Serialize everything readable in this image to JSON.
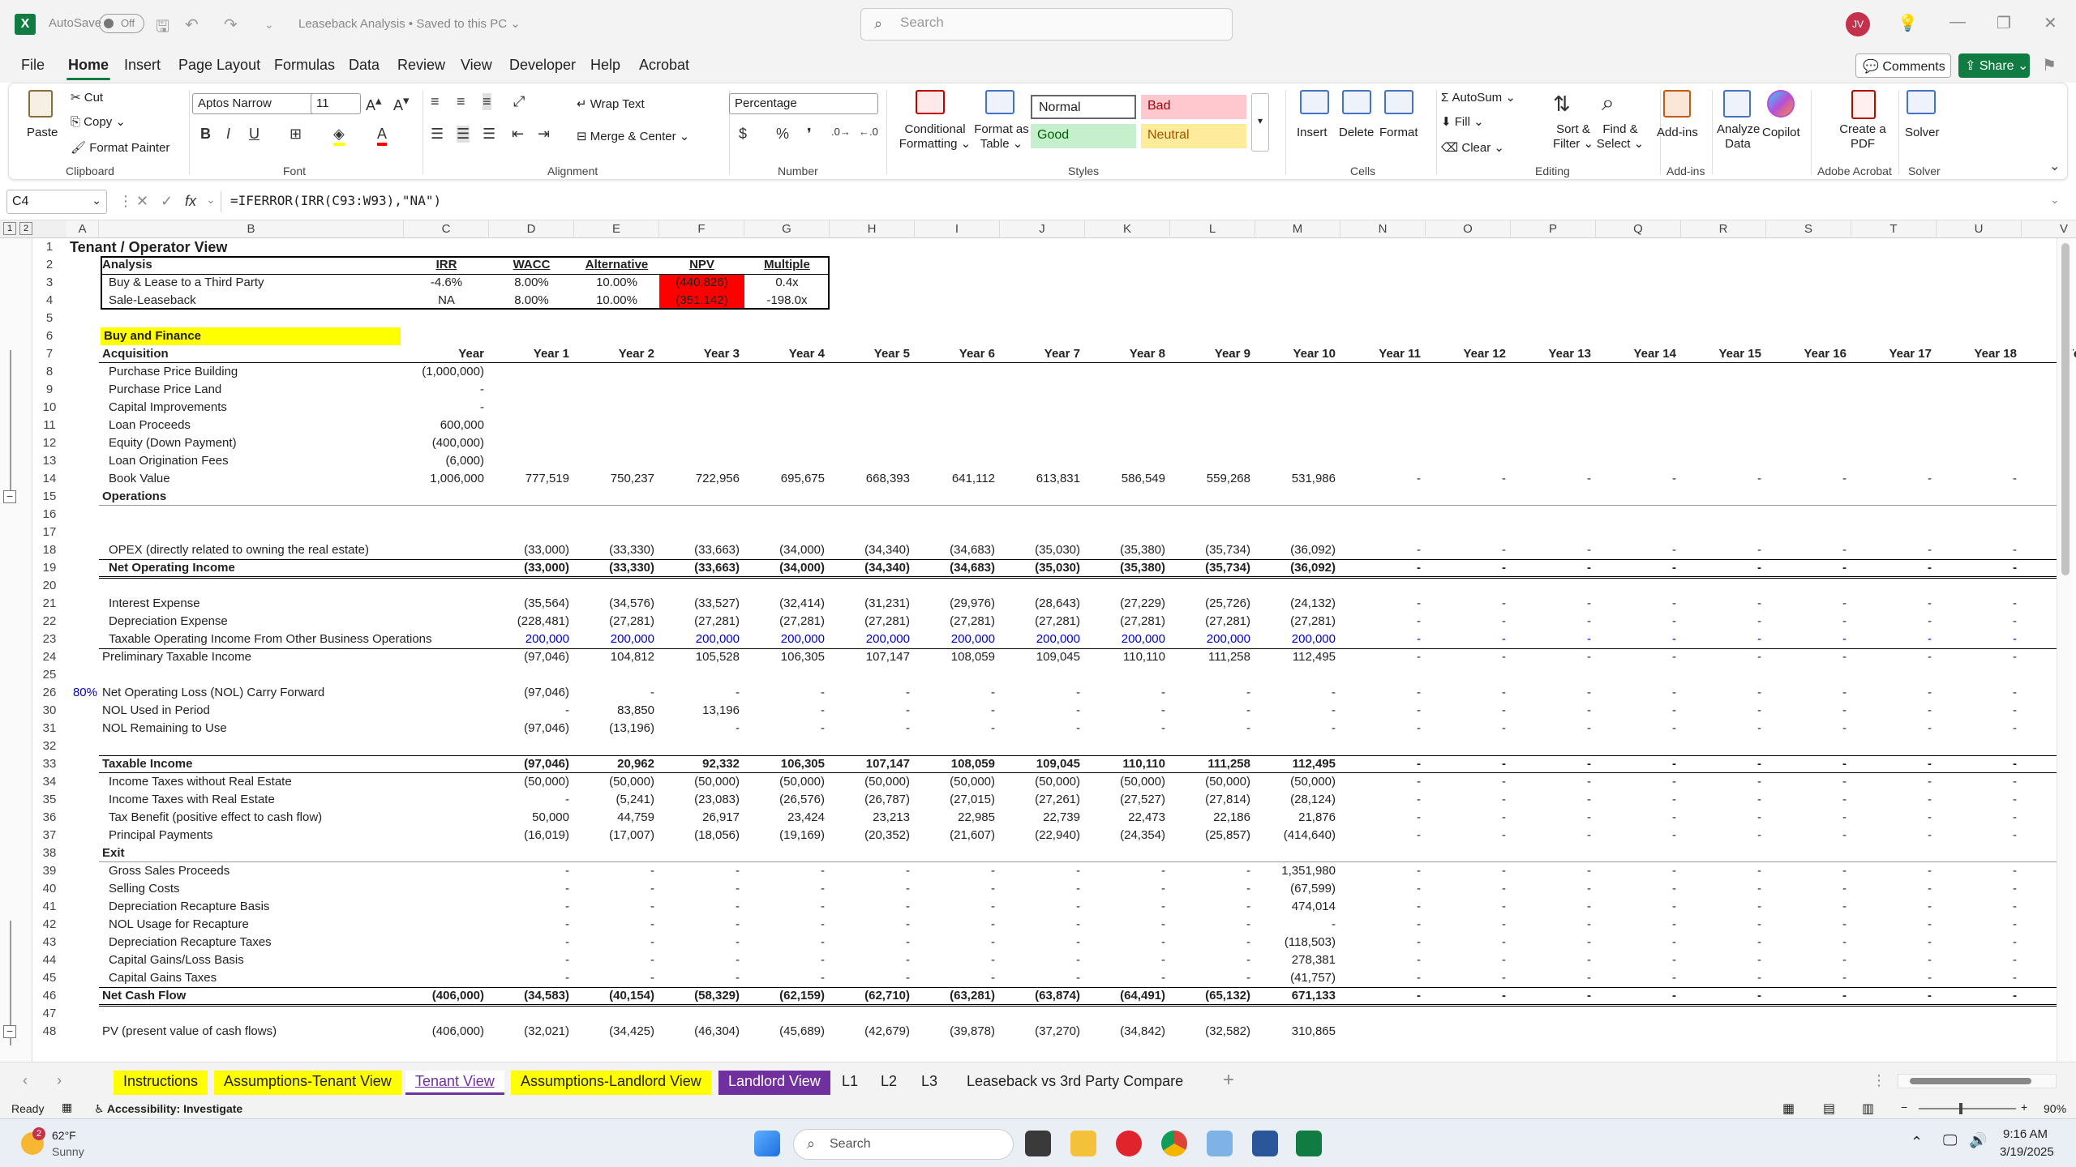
{
  "title": {
    "autosave": "AutoSave",
    "toggle": "Off",
    "doc": "Leaseback Analysis • Saved to this PC ⌄",
    "search": "Search",
    "avatar": "JV"
  },
  "menu": [
    "File",
    "Home",
    "Insert",
    "Page Layout",
    "Formulas",
    "Data",
    "Review",
    "View",
    "Developer",
    "Help",
    "Acrobat"
  ],
  "actions": {
    "comments": "Comments",
    "share": "Share ⌄"
  },
  "ribbon": {
    "clipboard": {
      "paste": "Paste",
      "cut": "Cut",
      "copy": "Copy ⌄",
      "format_painter": "Format Painter",
      "label": "Clipboard"
    },
    "font": {
      "name": "Aptos Narrow",
      "size": "11",
      "label": "Font"
    },
    "alignment": {
      "wrap": "Wrap Text",
      "merge": "Merge & Center ⌄",
      "label": "Alignment"
    },
    "number": {
      "format": "Percentage",
      "label": "Number"
    },
    "styles": {
      "cond": "Conditional Formatting ⌄",
      "table": "Format as Table ⌄",
      "normal": "Normal",
      "bad": "Bad",
      "good": "Good",
      "neutral": "Neutral",
      "label": "Styles"
    },
    "cells": {
      "insert": "Insert",
      "delete": "Delete",
      "format": "Format",
      "label": "Cells"
    },
    "editing": {
      "autosum": "AutoSum ⌄",
      "fill": "Fill ⌄",
      "clear": "Clear ⌄",
      "sort": "Sort & Filter ⌄",
      "find": "Find & Select ⌄",
      "label": "Editing"
    },
    "addins": {
      "addins": "Add-ins",
      "analyze": "Analyze Data",
      "copilot": "Copilot",
      "label": "Add-ins"
    },
    "acrobat": {
      "create": "Create a PDF",
      "label": "Adobe Acrobat"
    },
    "solver": {
      "solver": "Solver",
      "label": "Solver"
    }
  },
  "formula_bar": {
    "cell": "C4",
    "formula": "=IFERROR(IRR(C93:W93),\"NA\")"
  },
  "columns": [
    "A",
    "B",
    "C",
    "D",
    "E",
    "F",
    "G",
    "H",
    "I",
    "J",
    "K",
    "L",
    "M",
    "N",
    "O",
    "P",
    "Q",
    "R",
    "S",
    "T",
    "U",
    "V"
  ],
  "rows": [
    "1",
    "2",
    "3",
    "4",
    "5",
    "6",
    "7",
    "8",
    "9",
    "10",
    "11",
    "12",
    "13",
    "14",
    "15",
    "16",
    "17",
    "18",
    "19",
    "20",
    "21",
    "22",
    "23",
    "24",
    "25",
    "26",
    "30",
    "31",
    "32",
    "33",
    "34",
    "35",
    "36",
    "37",
    "38",
    "39",
    "40",
    "41",
    "42",
    "43",
    "44",
    "45",
    "46",
    "47",
    "48"
  ],
  "sheet": {
    "title": "Tenant / Operator View",
    "analysis": {
      "headers": [
        "Analysis",
        "IRR",
        "WACC",
        "Alternative",
        "NPV",
        "Multiple"
      ],
      "rows": [
        [
          "Buy & Lease to a Third Party",
          "-4.6%",
          "8.00%",
          "10.00%",
          "(440,826)",
          "0.4x"
        ],
        [
          "Sale-Leaseback",
          "NA",
          "8.00%",
          "10.00%",
          "(351,142)",
          "-198.0x"
        ]
      ]
    },
    "section_buy": "Buy and Finance",
    "acq_label": "Acquisition",
    "year_label": "Year",
    "years": [
      "Year 1",
      "Year 2",
      "Year 3",
      "Year 4",
      "Year 5",
      "Year 6",
      "Year 7",
      "Year 8",
      "Year 9",
      "Year 10",
      "Year 11",
      "Year 12",
      "Year 13",
      "Year 14",
      "Year 15",
      "Year 16",
      "Year 17",
      "Year 18",
      "Year 1"
    ],
    "acquisition": [
      [
        "Purchase Price Building",
        "(1,000,000)"
      ],
      [
        "Purchase Price Land",
        "-"
      ],
      [
        "Capital Improvements",
        "-"
      ],
      [
        "Loan Proceeds",
        "600,000"
      ],
      [
        "Equity (Down Payment)",
        "(400,000)"
      ],
      [
        "Loan Origination Fees",
        "(6,000)"
      ]
    ],
    "book_value": {
      "label": "Book Value",
      "c": "1,006,000",
      "vals": [
        "777,519",
        "750,237",
        "722,956",
        "695,675",
        "668,393",
        "641,112",
        "613,831",
        "586,549",
        "559,268",
        "531,986",
        "-",
        "-",
        "-",
        "-",
        "-",
        "-",
        "-",
        "-"
      ]
    },
    "operations": "Operations",
    "opex": {
      "label": "OPEX (directly related to owning the real estate)",
      "vals": [
        "(33,000)",
        "(33,330)",
        "(33,663)",
        "(34,000)",
        "(34,340)",
        "(34,683)",
        "(35,030)",
        "(35,380)",
        "(35,734)",
        "(36,092)",
        "-",
        "-",
        "-",
        "-",
        "-",
        "-",
        "-",
        "-"
      ]
    },
    "noi": {
      "label": "Net Operating Income",
      "vals": [
        "(33,000)",
        "(33,330)",
        "(33,663)",
        "(34,000)",
        "(34,340)",
        "(34,683)",
        "(35,030)",
        "(35,380)",
        "(35,734)",
        "(36,092)",
        "-",
        "-",
        "-",
        "-",
        "-",
        "-",
        "-",
        "-"
      ]
    },
    "interest": {
      "label": "Interest Expense",
      "vals": [
        "(35,564)",
        "(34,576)",
        "(33,527)",
        "(32,414)",
        "(31,231)",
        "(29,976)",
        "(28,643)",
        "(27,229)",
        "(25,726)",
        "(24,132)",
        "-",
        "-",
        "-",
        "-",
        "-",
        "-",
        "-",
        "-"
      ]
    },
    "depreciation": {
      "label": "Depreciation Expense",
      "vals": [
        "(228,481)",
        "(27,281)",
        "(27,281)",
        "(27,281)",
        "(27,281)",
        "(27,281)",
        "(27,281)",
        "(27,281)",
        "(27,281)",
        "(27,281)",
        "-",
        "-",
        "-",
        "-",
        "-",
        "-",
        "-",
        "-"
      ]
    },
    "taxable_other": {
      "label": "Taxable Operating Income From Other Business Operations",
      "vals": [
        "200,000",
        "200,000",
        "200,000",
        "200,000",
        "200,000",
        "200,000",
        "200,000",
        "200,000",
        "200,000",
        "200,000",
        "-",
        "-",
        "-",
        "-",
        "-",
        "-",
        "-",
        "-"
      ]
    },
    "prelim": {
      "label": "Preliminary Taxable Income",
      "vals": [
        "(97,046)",
        "104,812",
        "105,528",
        "106,305",
        "107,147",
        "108,059",
        "109,045",
        "110,110",
        "111,258",
        "112,495",
        "-",
        "-",
        "-",
        "-",
        "-",
        "-",
        "-",
        "-"
      ]
    },
    "nol_pct": "80%",
    "nol_cf": {
      "label": "Net Operating Loss (NOL) Carry Forward",
      "vals": [
        "(97,046)",
        "-",
        "-",
        "-",
        "-",
        "-",
        "-",
        "-",
        "-",
        "-",
        "-",
        "-",
        "-",
        "-",
        "-",
        "-",
        "-",
        "-"
      ]
    },
    "nol_used": {
      "label": "NOL Used in Period",
      "vals": [
        "-",
        "83,850",
        "13,196",
        "-",
        "-",
        "-",
        "-",
        "-",
        "-",
        "-",
        "-",
        "-",
        "-",
        "-",
        "-",
        "-",
        "-",
        "-"
      ]
    },
    "nol_rem": {
      "label": "NOL Remaining to Use",
      "vals": [
        "(97,046)",
        "(13,196)",
        "-",
        "-",
        "-",
        "-",
        "-",
        "-",
        "-",
        "-",
        "-",
        "-",
        "-",
        "-",
        "-",
        "-",
        "-",
        "-"
      ]
    },
    "taxable": {
      "label": "Taxable Income",
      "vals": [
        "(97,046)",
        "20,962",
        "92,332",
        "106,305",
        "107,147",
        "108,059",
        "109,045",
        "110,110",
        "111,258",
        "112,495",
        "-",
        "-",
        "-",
        "-",
        "-",
        "-",
        "-",
        "-"
      ]
    },
    "tax_wo": {
      "label": "Income Taxes without Real Estate",
      "vals": [
        "(50,000)",
        "(50,000)",
        "(50,000)",
        "(50,000)",
        "(50,000)",
        "(50,000)",
        "(50,000)",
        "(50,000)",
        "(50,000)",
        "(50,000)",
        "-",
        "-",
        "-",
        "-",
        "-",
        "-",
        "-",
        "-"
      ]
    },
    "tax_w": {
      "label": "Income Taxes with Real Estate",
      "vals": [
        "-",
        "(5,241)",
        "(23,083)",
        "(26,576)",
        "(26,787)",
        "(27,015)",
        "(27,261)",
        "(27,527)",
        "(27,814)",
        "(28,124)",
        "-",
        "-",
        "-",
        "-",
        "-",
        "-",
        "-",
        "-"
      ]
    },
    "tax_benefit": {
      "label": "Tax Benefit (positive effect to cash flow)",
      "vals": [
        "50,000",
        "44,759",
        "26,917",
        "23,424",
        "23,213",
        "22,985",
        "22,739",
        "22,473",
        "22,186",
        "21,876",
        "-",
        "-",
        "-",
        "-",
        "-",
        "-",
        "-",
        "-"
      ]
    },
    "principal": {
      "label": "Principal Payments",
      "vals": [
        "(16,019)",
        "(17,007)",
        "(18,056)",
        "(19,169)",
        "(20,352)",
        "(21,607)",
        "(22,940)",
        "(24,354)",
        "(25,857)",
        "(414,640)",
        "-",
        "-",
        "-",
        "-",
        "-",
        "-",
        "-",
        "-"
      ]
    },
    "exit": "Exit",
    "gross": {
      "label": "Gross Sales Proceeds",
      "vals": [
        "-",
        "-",
        "-",
        "-",
        "-",
        "-",
        "-",
        "-",
        "-",
        "1,351,980",
        "-",
        "-",
        "-",
        "-",
        "-",
        "-",
        "-",
        "-"
      ]
    },
    "selling": {
      "label": "Selling Costs",
      "vals": [
        "-",
        "-",
        "-",
        "-",
        "-",
        "-",
        "-",
        "-",
        "-",
        "(67,599)",
        "-",
        "-",
        "-",
        "-",
        "-",
        "-",
        "-",
        "-"
      ]
    },
    "dep_basis": {
      "label": "Depreciation Recapture Basis",
      "vals": [
        "-",
        "-",
        "-",
        "-",
        "-",
        "-",
        "-",
        "-",
        "-",
        "474,014",
        "-",
        "-",
        "-",
        "-",
        "-",
        "-",
        "-",
        "-"
      ]
    },
    "nol_recap": {
      "label": "NOL Usage for Recapture",
      "vals": [
        "-",
        "-",
        "-",
        "-",
        "-",
        "-",
        "-",
        "-",
        "-",
        "-",
        "-",
        "-",
        "-",
        "-",
        "-",
        "-",
        "-",
        "-"
      ]
    },
    "dep_tax": {
      "label": "Depreciation Recapture Taxes",
      "vals": [
        "-",
        "-",
        "-",
        "-",
        "-",
        "-",
        "-",
        "-",
        "-",
        "(118,503)",
        "-",
        "-",
        "-",
        "-",
        "-",
        "-",
        "-",
        "-"
      ]
    },
    "cg_basis": {
      "label": "Capital Gains/Loss Basis",
      "vals": [
        "-",
        "-",
        "-",
        "-",
        "-",
        "-",
        "-",
        "-",
        "-",
        "278,381",
        "-",
        "-",
        "-",
        "-",
        "-",
        "-",
        "-",
        "-"
      ]
    },
    "cg_tax": {
      "label": "Capital Gains Taxes",
      "vals": [
        "-",
        "-",
        "-",
        "-",
        "-",
        "-",
        "-",
        "-",
        "-",
        "(41,757)",
        "-",
        "-",
        "-",
        "-",
        "-",
        "-",
        "-",
        "-"
      ]
    },
    "ncf": {
      "label": "Net Cash Flow",
      "c": "(406,000)",
      "vals": [
        "(34,583)",
        "(40,154)",
        "(58,329)",
        "(62,159)",
        "(62,710)",
        "(63,281)",
        "(63,874)",
        "(64,491)",
        "(65,132)",
        "671,133",
        "-",
        "-",
        "-",
        "-",
        "-",
        "-",
        "-",
        "-"
      ]
    },
    "pv": {
      "label": "PV (present value of cash flows)",
      "c": "(406,000)",
      "vals": [
        "(32,021)",
        "(34,425)",
        "(46,304)",
        "(45,689)",
        "(42,679)",
        "(39,878)",
        "(37,270)",
        "(34,842)",
        "(32,582)",
        "310,865"
      ]
    }
  },
  "tabs": [
    "Instructions",
    "Assumptions-Tenant View",
    "Tenant View",
    "Assumptions-Landlord View",
    "Landlord View",
    "L1",
    "L2",
    "L3",
    "Leaseback vs 3rd Party Compare"
  ],
  "status": {
    "ready": "Ready",
    "accessibility": "Accessibility: Investigate",
    "zoom": "90%"
  },
  "taskbar": {
    "temp": "62°F",
    "weather": "Sunny",
    "search": "Search",
    "time": "9:16 AM",
    "date": "3/19/2025",
    "badge": "2"
  }
}
